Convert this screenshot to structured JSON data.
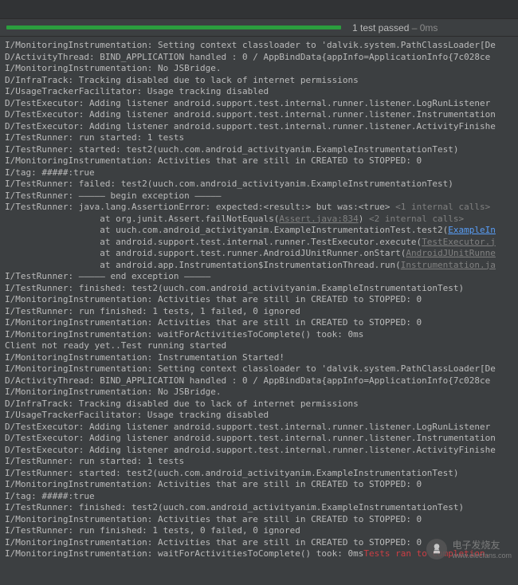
{
  "status": {
    "count_text": "1 test passed",
    "time_text": " – 0ms"
  },
  "watermark": {
    "text": "电子发烧友",
    "url": "www.elecfans.com"
  },
  "log_lines": [
    {
      "t": "I/MonitoringInstrumentation: Setting context classloader to 'dalvik.system.PathClassLoader[De"
    },
    {
      "t": "D/ActivityThread: BIND_APPLICATION handled : 0 / AppBindData{appInfo=ApplicationInfo{7c028ce"
    },
    {
      "t": "I/MonitoringInstrumentation: No JSBridge."
    },
    {
      "t": "D/InfraTrack: Tracking disabled due to lack of internet permissions"
    },
    {
      "t": "I/UsageTrackerFacilitator: Usage tracking disabled"
    },
    {
      "t": "D/TestExecutor: Adding listener android.support.test.internal.runner.listener.LogRunListener"
    },
    {
      "t": "D/TestExecutor: Adding listener android.support.test.internal.runner.listener.Instrumentation"
    },
    {
      "t": "D/TestExecutor: Adding listener android.support.test.internal.runner.listener.ActivityFinishe"
    },
    {
      "t": "I/TestRunner: run started: 1 tests"
    },
    {
      "t": "I/TestRunner: started: test2(uuch.com.android_activityanim.ExampleInstrumentationTest)"
    },
    {
      "t": "I/MonitoringInstrumentation: Activities that are still in CREATED to STOPPED: 0"
    },
    {
      "t": "I/tag: #####:true"
    },
    {
      "t": "I/TestRunner: failed: test2(uuch.com.android_activityanim.ExampleInstrumentationTest)"
    },
    {
      "t": "I/TestRunner: ––––– begin exception –––––"
    },
    {
      "pre": "I/TestRunner: java.lang.AssertionError: expected:<result:> but was:<true> ",
      "dim": "<1 internal calls>"
    },
    {
      "pre": "                  at org.junit.Assert.failNotEquals(",
      "linkdim": "Assert.java:834",
      "post": ") ",
      "dim": "<2 internal calls>"
    },
    {
      "pre": "                  at uuch.com.android_activityanim.ExampleInstrumentationTest.test2(",
      "link": "ExampleIn"
    },
    {
      "pre": "                  at android.support.test.internal.runner.TestExecutor.execute(",
      "linkdim": "TestExecutor.j"
    },
    {
      "pre": "                  at android.support.test.runner.AndroidJUnitRunner.onStart(",
      "linkdim": "AndroidJUnitRunne"
    },
    {
      "pre": "                  at android.app.Instrumentation$InstrumentationThread.run(",
      "linkdim": "Instrumentation.ja"
    },
    {
      "t": "I/TestRunner: ––––– end exception –––––"
    },
    {
      "t": "I/TestRunner: finished: test2(uuch.com.android_activityanim.ExampleInstrumentationTest)"
    },
    {
      "t": "I/MonitoringInstrumentation: Activities that are still in CREATED to STOPPED: 0"
    },
    {
      "t": "I/TestRunner: run finished: 1 tests, 1 failed, 0 ignored"
    },
    {
      "t": "I/MonitoringInstrumentation: Activities that are still in CREATED to STOPPED: 0"
    },
    {
      "t": "I/MonitoringInstrumentation: waitForActivitiesToComplete() took: 0ms"
    },
    {
      "t": "Client not ready yet..Test running started"
    },
    {
      "t": "I/MonitoringInstrumentation: Instrumentation Started!"
    },
    {
      "t": "I/MonitoringInstrumentation: Setting context classloader to 'dalvik.system.PathClassLoader[De"
    },
    {
      "t": "D/ActivityThread: BIND_APPLICATION handled : 0 / AppBindData{appInfo=ApplicationInfo{7c028ce"
    },
    {
      "t": "I/MonitoringInstrumentation: No JSBridge."
    },
    {
      "t": "D/InfraTrack: Tracking disabled due to lack of internet permissions"
    },
    {
      "t": "I/UsageTrackerFacilitator: Usage tracking disabled"
    },
    {
      "t": "D/TestExecutor: Adding listener android.support.test.internal.runner.listener.LogRunListener"
    },
    {
      "t": "D/TestExecutor: Adding listener android.support.test.internal.runner.listener.Instrumentation"
    },
    {
      "t": "D/TestExecutor: Adding listener android.support.test.internal.runner.listener.ActivityFinishe"
    },
    {
      "t": "I/TestRunner: run started: 1 tests"
    },
    {
      "t": "I/TestRunner: started: test2(uuch.com.android_activityanim.ExampleInstrumentationTest)"
    },
    {
      "t": "I/MonitoringInstrumentation: Activities that are still in CREATED to STOPPED: 0"
    },
    {
      "t": "I/tag: #####:true"
    },
    {
      "t": "I/TestRunner: finished: test2(uuch.com.android_activityanim.ExampleInstrumentationTest)"
    },
    {
      "t": "I/MonitoringInstrumentation: Activities that are still in CREATED to STOPPED: 0"
    },
    {
      "t": "I/TestRunner: run finished: 1 tests, 0 failed, 0 ignored"
    },
    {
      "t": "I/MonitoringInstrumentation: Activities that are still in CREATED to STOPPED: 0"
    },
    {
      "pre": "I/MonitoringInstrumentation: waitForActivitiesToComplete() took: 0ms",
      "red": "Tests ran to completion."
    }
  ]
}
